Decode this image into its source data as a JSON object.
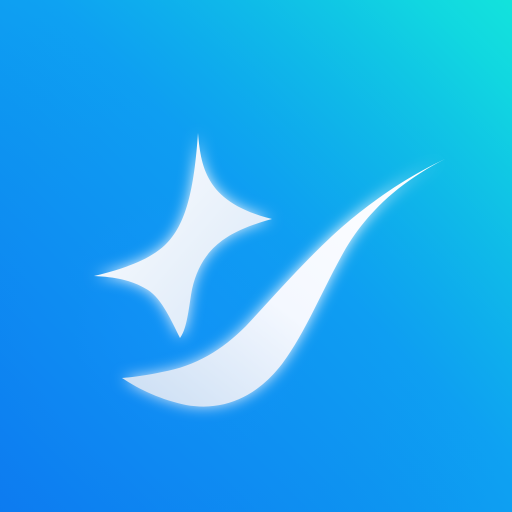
{
  "icon": {
    "name": "sparkle-checkmark-app-icon",
    "colors": {
      "background_start": "#0d7cf2",
      "background_end": "#12e3dc",
      "symbol": "#f4f8ff",
      "symbol_shade": "#c9ddf3",
      "glow": "#ffffff"
    },
    "symbols": [
      "sparkle-icon",
      "checkmark-swoosh-icon"
    ]
  }
}
